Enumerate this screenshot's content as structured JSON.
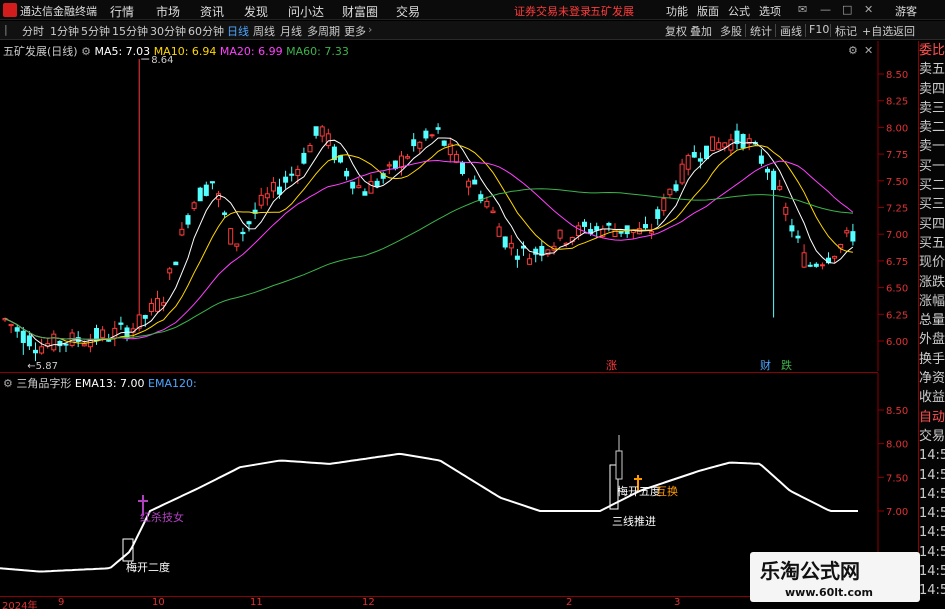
{
  "titlebar": {
    "app_name": "通达信金融终端",
    "menus": [
      "行情",
      "市场",
      "资讯",
      "发现",
      "问小达",
      "财富圈",
      "交易"
    ],
    "notice": "证券交易未登录",
    "stock_name": "五矿发展",
    "right_menus": [
      "功能",
      "版面",
      "公式",
      "选项"
    ],
    "user": "游客"
  },
  "toolbar": {
    "periods": [
      "分时",
      "1分钟",
      "5分钟",
      "15分钟",
      "30分钟",
      "60分钟",
      "日线",
      "周线",
      "月线",
      "多周期",
      "更多"
    ],
    "active_period": "日线",
    "right_items": [
      "复权",
      "叠加",
      "多股",
      "统计",
      "画线",
      "F10",
      "标记",
      "+自选",
      "返回"
    ]
  },
  "main_chart": {
    "title": "五矿发展(日线)",
    "ma": [
      {
        "label": "MA5: 7.03",
        "color": "#ffffff"
      },
      {
        "label": "MA10: 6.94",
        "color": "#ffd700"
      },
      {
        "label": "MA20: 6.99",
        "color": "#ff40ff"
      },
      {
        "label": "MA60: 7.33",
        "color": "#3cb44b"
      }
    ],
    "price_ticks": [
      "8.50",
      "8.25",
      "8.00",
      "7.75",
      "7.50",
      "7.25",
      "7.00",
      "6.75",
      "6.50",
      "6.25",
      "6.00"
    ],
    "high_label": "8.64",
    "low_label": "5.87",
    "markers": [
      {
        "text": "涨",
        "color": "#ff3b3b"
      },
      {
        "text": "财",
        "color": "#4da6ff"
      },
      {
        "text": "跌",
        "color": "#3cb44b"
      }
    ]
  },
  "sub_chart": {
    "title": "三角品字形",
    "ema13": "EMA13: 7.00",
    "ema120": "EMA120:",
    "ticks": [
      "8.50",
      "8.00",
      "7.50",
      "7.00"
    ],
    "signals": [
      {
        "text": "红杀技女",
        "color": "#b040c0"
      },
      {
        "text": "梅开二度",
        "color": "#ffffff"
      },
      {
        "text": "梅开五度",
        "color": "#ffffff"
      },
      {
        "text": "三线推进",
        "color": "#ffffff"
      },
      {
        "text": "互换",
        "color": "#ff9900"
      }
    ]
  },
  "right_panel": {
    "items": [
      "委比",
      "卖五",
      "卖四",
      "卖三",
      "卖二",
      "卖一",
      "买一",
      "买二",
      "买三",
      "买四",
      "买五",
      "现价",
      "涨跌",
      "涨幅",
      "总量",
      "外盘",
      "换手",
      "净资",
      "收益",
      "自动",
      "交易",
      "14:56",
      "14:56",
      "14:56",
      "14:56",
      "14:56",
      "14:56",
      "14:56",
      "14:56"
    ]
  },
  "time_axis": {
    "labels": [
      "2024年",
      "9",
      "10",
      "11",
      "12",
      "2",
      "3"
    ]
  },
  "watermark": {
    "title": "乐淘公式网",
    "url": "www.60lt.com"
  }
}
